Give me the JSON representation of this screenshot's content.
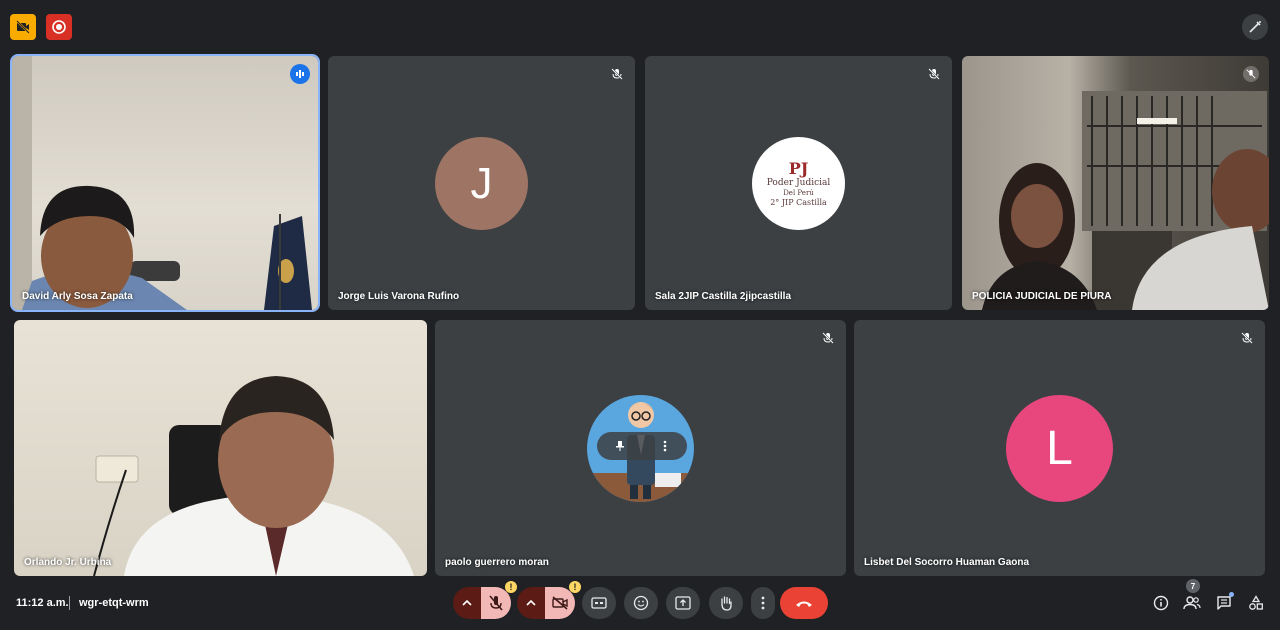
{
  "participants": [
    {
      "name": "David Arly Sosa Zapata"
    },
    {
      "name": "Jorge Luis Varona Rufino",
      "initial": "J",
      "avatar_color": "#9e7464"
    },
    {
      "name": "Sala 2JIP Castilla 2jipcastilla",
      "logo": {
        "mark": "PJ",
        "line1": "Poder Judicial",
        "line2": "Del Perú",
        "line3": "2° JIP Castilla"
      }
    },
    {
      "name": "POLICIA JUDICIAL DE PIURA"
    },
    {
      "name": "Orlando Jr. Urbina"
    },
    {
      "name": "paolo guerrero moran"
    },
    {
      "name": "Lisbet Del Socorro Huaman Gaona",
      "initial": "L",
      "avatar_color": "#e8477e"
    }
  ],
  "footer": {
    "time": "11:12 a.m.",
    "meeting_code": "wgr-etqt-wrm",
    "warning_mark": "!",
    "participant_count": "7"
  },
  "colors": {
    "background": "#202124",
    "tile": "#3c4043",
    "active_outline": "#8ab4f8",
    "end_call": "#ea4335"
  }
}
